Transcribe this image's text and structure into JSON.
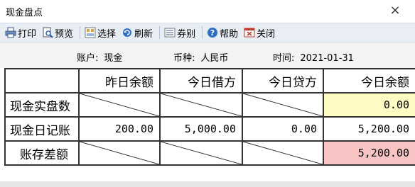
{
  "window": {
    "title": "现金盘点",
    "close_label": "×"
  },
  "toolbar": {
    "items": [
      {
        "label": "打印",
        "icon": "printer-icon"
      },
      {
        "label": "预览",
        "icon": "preview-icon"
      },
      {
        "label": "选择",
        "icon": "select-icon"
      },
      {
        "label": "刷新",
        "icon": "refresh-icon"
      },
      {
        "label": "券别",
        "icon": "denomination-icon"
      },
      {
        "label": "帮助",
        "icon": "help-icon"
      },
      {
        "label": "关闭",
        "icon": "close-window-icon"
      }
    ]
  },
  "info": {
    "account_label": "账户:",
    "account_value": "现金",
    "currency_label": "币种:",
    "currency_value": "人民币",
    "time_label": "时间:",
    "time_value": "2021-01-31"
  },
  "table": {
    "headers": [
      "",
      "昨日余额",
      "今日借方",
      "今日贷方",
      "今日余额"
    ],
    "rows": [
      {
        "label": "现金实盘数",
        "cells": [
          "",
          "",
          "",
          "0.00"
        ]
      },
      {
        "label": "现金日记账",
        "cells": [
          "200.00",
          "5,000.00",
          "0.00",
          "5,200.00"
        ]
      },
      {
        "label": "账存差额",
        "cells": [
          "",
          "",
          "",
          "5,200.00"
        ]
      }
    ]
  },
  "colors": {
    "toolbar_bg": "#e9eef5",
    "infobar_bg": "#f3f3f3",
    "physical_balance_bg": "#fffbc4",
    "difference_bg": "#f8c4c4"
  }
}
